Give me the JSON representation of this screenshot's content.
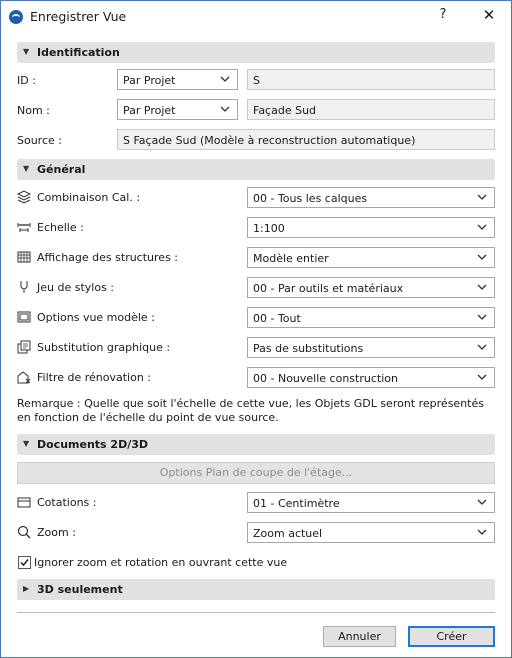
{
  "window": {
    "title": "Enregistrer Vue",
    "help_label": "?",
    "close_label": "✕"
  },
  "identification": {
    "header": "Identification",
    "id_label": "ID :",
    "id_mode": "Par Projet",
    "id_value": "S",
    "name_label": "Nom :",
    "name_mode": "Par Projet",
    "name_value": "Façade Sud",
    "source_label": "Source :",
    "source_value": "S Façade Sud (Modèle à reconstruction automatique)"
  },
  "general": {
    "header": "Général",
    "rows": [
      {
        "label": "Combinaison Cal. :",
        "value": "00 - Tous les calques",
        "icon": "layers-icon"
      },
      {
        "label": "Echelle :",
        "value": "1:100",
        "icon": "scale-icon"
      },
      {
        "label": "Affichage des structures :",
        "value": "Modèle entier",
        "icon": "structure-display-icon"
      },
      {
        "label": "Jeu de stylos :",
        "value": "00 - Par outils et matériaux",
        "icon": "pen-icon"
      },
      {
        "label": "Options vue modèle :",
        "value": "00 - Tout",
        "icon": "model-view-icon"
      },
      {
        "label": "Substitution graphique :",
        "value": "Pas de substitutions",
        "icon": "graphic-override-icon"
      },
      {
        "label": "Filtre de rénovation :",
        "value": "00 - Nouvelle construction",
        "icon": "renovation-filter-icon"
      }
    ],
    "note": "Remarque : Quelle que soit l'échelle de cette vue, les Objets GDL seront représentés en fonction de l'échelle du point de vue source."
  },
  "documents": {
    "header": "Documents 2D/3D",
    "section_options_button": "Options Plan de coupe de l'étage...",
    "dimensions_label": "Cotations :",
    "dimensions_value": "01 - Centimètre",
    "zoom_label": "Zoom :",
    "zoom_value": "Zoom actuel",
    "ignore_zoom_label": "Ignorer zoom et rotation en ouvrant cette vue",
    "ignore_zoom_checked": true
  },
  "only3d": {
    "header": "3D seulement"
  },
  "footer": {
    "cancel_label": "Annuler",
    "create_label": "Créer"
  },
  "colors": {
    "window_border": "#4a79b4",
    "section_bg": "#e1e1e1",
    "primary_border": "#1f7ad6"
  }
}
